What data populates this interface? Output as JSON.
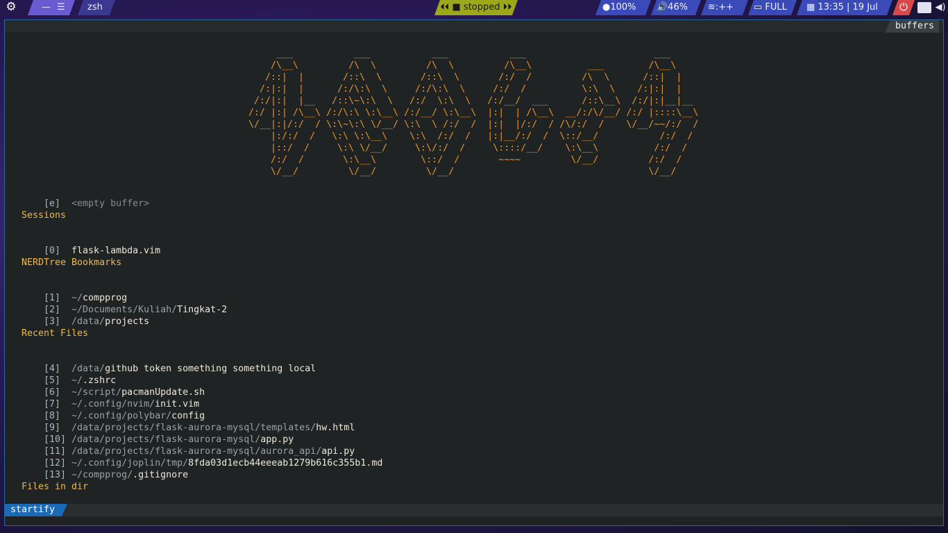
{
  "topbar": {
    "workspace_labels": [
      "—",
      "☰"
    ],
    "window_title": "zsh",
    "player": {
      "prev_icon": "⏴⏴",
      "stop_icon": "■",
      "status": "stopped",
      "next_icon": "⏵⏵"
    },
    "brightness": "●100%",
    "volume": "🔊46%",
    "wifi": ":++",
    "battery": "FULL",
    "clock": "13:35 | 19 Jul"
  },
  "colors": {
    "accent": "#1a6ab8",
    "heading": "#f0b84a",
    "ascii_art": "#e8952a",
    "background": "#1f2324"
  },
  "tabline": {
    "buffers_label": "buffers"
  },
  "startify": {
    "ascii_art": "      ___           ___           ___           ___                       ___     \n     /\\__\\         /\\  \\         /\\  \\         /\\__\\          ___        /\\__\\    \n    /::|  |       /::\\  \\       /::\\  \\       /:/  /         /\\  \\      /::|  |   \n   /:|:|  |      /:/\\:\\  \\     /:/\\:\\  \\     /:/  /          \\:\\  \\    /:|:|  |   \n  /:/|:|  |__   /::\\~\\:\\  \\   /:/  \\:\\  \\   /:/__/  ___      /::\\__\\  /:/|:|__|__ \n /:/ |:| /\\__\\ /:/\\:\\ \\:\\__\\ /:/__/ \\:\\__\\  |:|  | /\\__\\  __/:/\\/__/ /:/ |::::\\__\\\n \\/__|:|/:/  / \\:\\~\\:\\ \\/__/ \\:\\  \\ /:/  /  |:|  |/:/  / /\\/:/  /    \\/__/~~/:/  /\n     |:/:/  /   \\:\\ \\:\\__\\    \\:\\  /:/  /   |:|__/:/  /  \\::/__/           /:/  / \n     |::/  /     \\:\\ \\/__/     \\:\\/:/  /     \\::::/__/    \\:\\__\\          /:/  /  \n     /:/  /       \\:\\__\\        \\::/  /       ~~~~         \\/__/         /:/  /   \n     \\/__/         \\/__/         \\/__/                                   \\/__/    ",
    "empty": {
      "index": "[e]",
      "label": "<empty buffer>"
    },
    "sessions": {
      "heading": "Sessions",
      "items": [
        {
          "index": "[0]",
          "name": "flask-lambda.vim"
        }
      ]
    },
    "bookmarks": {
      "heading": "NERDTree Bookmarks",
      "items": [
        {
          "index": "[1]",
          "dir": "~/",
          "name": "compprog"
        },
        {
          "index": "[2]",
          "dir": "~/Documents/Kuliah/",
          "name": "Tingkat-2"
        },
        {
          "index": "[3]",
          "dir": "/data/",
          "name": "projects"
        }
      ]
    },
    "recent": {
      "heading": "Recent Files",
      "items": [
        {
          "index": "[4]",
          "dir": "/data/",
          "name": "github token something something local"
        },
        {
          "index": "[5]",
          "dir": "~/",
          "name": ".zshrc"
        },
        {
          "index": "[6]",
          "dir": "~/script/",
          "name": "pacmanUpdate.sh"
        },
        {
          "index": "[7]",
          "dir": "~/.config/nvim/",
          "name": "init.vim"
        },
        {
          "index": "[8]",
          "dir": "~/.config/polybar/",
          "name": "config"
        },
        {
          "index": "[9]",
          "dir": "/data/projects/flask-aurora-mysql/templates/",
          "name": "hw.html"
        },
        {
          "index": "[10]",
          "dir": "/data/projects/flask-aurora-mysql/",
          "name": "app.py"
        },
        {
          "index": "[11]",
          "dir": "/data/projects/flask-aurora-mysql/aurora_api/",
          "name": "api.py"
        },
        {
          "index": "[12]",
          "dir": "~/.config/joplin/tmp/",
          "name": "8fda03d1ecb44eeeab1279b616c355b1.md"
        },
        {
          "index": "[13]",
          "dir": "~/compprog/",
          "name": ".gitignore"
        }
      ]
    },
    "files_in_dir": {
      "heading": "Files in dir"
    }
  },
  "statusline": {
    "mode": "startify"
  }
}
